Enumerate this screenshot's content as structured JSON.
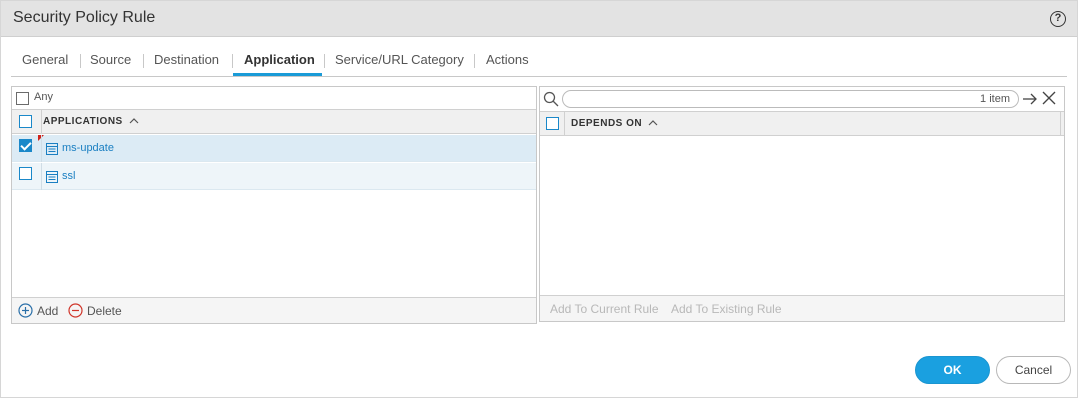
{
  "dialog": {
    "title": "Security Policy Rule",
    "help_icon": "help-icon"
  },
  "tabs": [
    {
      "label": "General"
    },
    {
      "label": "Source"
    },
    {
      "label": "Destination"
    },
    {
      "label": "Application",
      "active": true
    },
    {
      "label": "Service/URL Category"
    },
    {
      "label": "Actions"
    }
  ],
  "applications_panel": {
    "any_label": "Any",
    "any_checked": false,
    "column_header": "APPLICATIONS",
    "rows": [
      {
        "name": "ms-update",
        "checked": true,
        "selected": true
      },
      {
        "name": "ssl",
        "checked": false,
        "selected": false
      }
    ],
    "add_label": "Add",
    "delete_label": "Delete"
  },
  "depends_panel": {
    "item_count": "1 item",
    "column_header": "DEPENDS ON",
    "add_current_label": "Add To Current Rule",
    "add_existing_label": "Add To Existing Rule"
  },
  "buttons": {
    "ok": "OK",
    "cancel": "Cancel"
  },
  "colors": {
    "accent": "#1aa0e0",
    "link": "#1a7fc2",
    "selected_row": "#dcebf5",
    "flag": "#d0221a"
  }
}
